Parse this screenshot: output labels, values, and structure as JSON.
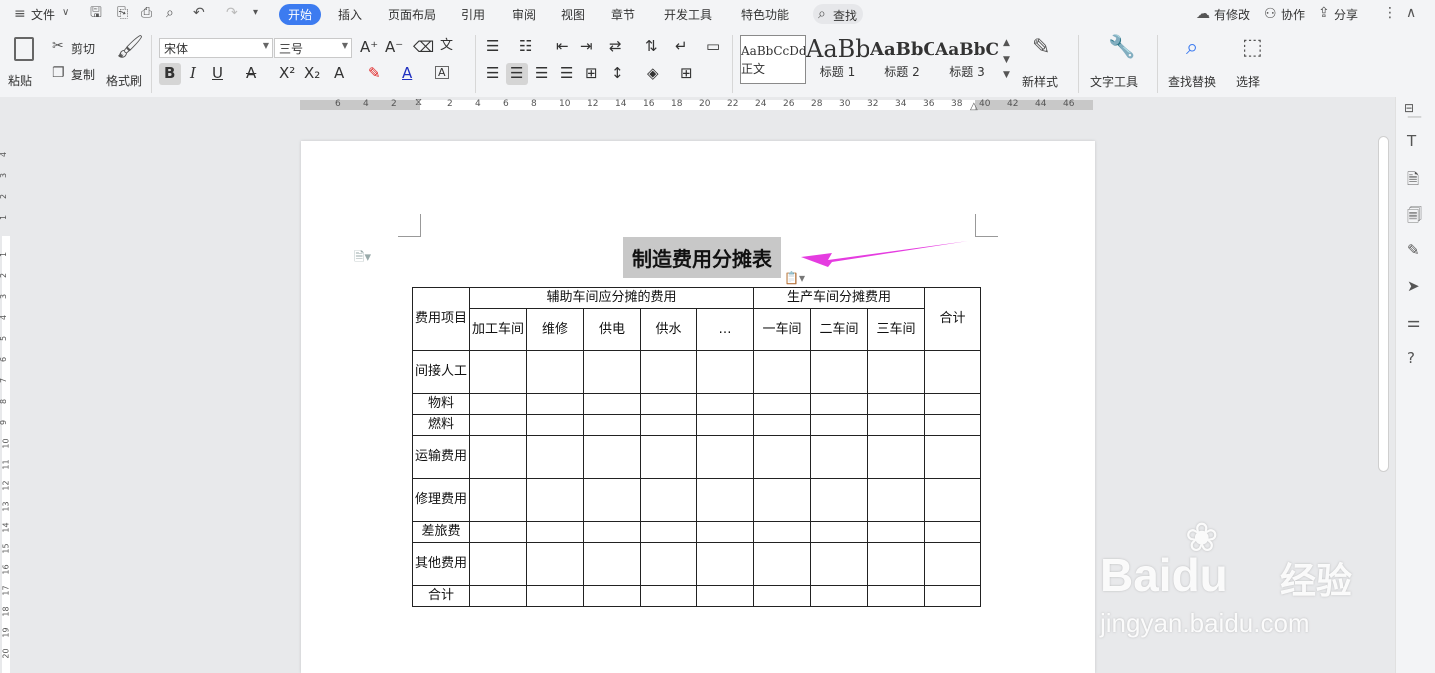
{
  "menubar": {
    "file_label": "文件",
    "tabs": [
      "开始",
      "插入",
      "页面布局",
      "引用",
      "审阅",
      "视图",
      "章节",
      "开发工具",
      "特色功能"
    ],
    "search_label": "查找",
    "modified_label": "有修改",
    "collab_label": "协作",
    "share_label": "分享"
  },
  "ribbon": {
    "paste_label": "粘贴",
    "cut_label": "剪切",
    "copy_label": "复制",
    "format_painter_label": "格式刷",
    "font_name": "宋体",
    "font_size": "三号",
    "styles": [
      {
        "sample": "AaBbCcDd",
        "name": "正文"
      },
      {
        "sample": "AaBb",
        "name": "标题 1"
      },
      {
        "sample": "AaBbC",
        "name": "标题 2"
      },
      {
        "sample": "AaBbC",
        "name": "标题 3"
      }
    ],
    "new_style_label": "新样式",
    "text_tools_label": "文字工具",
    "find_replace_label": "查找替换",
    "select_label": "选择"
  },
  "ruler": {
    "h_numbers": [
      "6",
      "4",
      "2",
      "2",
      "4",
      "6",
      "8",
      "10",
      "12",
      "14",
      "16",
      "18",
      "20",
      "22",
      "24",
      "26",
      "28",
      "30",
      "32",
      "34",
      "36",
      "38",
      "40",
      "42",
      "44",
      "46"
    ],
    "v_numbers": [
      "4",
      "3",
      "2",
      "1",
      "1",
      "2",
      "3",
      "4",
      "5",
      "6",
      "7",
      "8",
      "9",
      "10",
      "11",
      "12",
      "13",
      "14",
      "15",
      "16",
      "17",
      "18",
      "19",
      "20"
    ]
  },
  "document": {
    "title": "制造费用分摊表",
    "table": {
      "h_item": "费用项目",
      "h_aux": "辅助车间应分摊的费用",
      "h_prod": "生产车间分摊费用",
      "h_total": "合计",
      "aux_cols": [
        "加工车间",
        "维修",
        "供电",
        "供水",
        "…"
      ],
      "prod_cols": [
        "一车间",
        "二车间",
        "三车间"
      ],
      "rows": [
        "间接人工",
        "物料",
        "燃料",
        "运输费用",
        "修理费用",
        "差旅费",
        "其他费用",
        "合计"
      ]
    }
  },
  "colors": {
    "accent": "#3c7bf0",
    "arrow": "#e53ce0",
    "selection": "#c8c8c8"
  },
  "watermark": {
    "brand": "Baidu",
    "cn": "经验",
    "url": "jingyan.baidu.com"
  }
}
